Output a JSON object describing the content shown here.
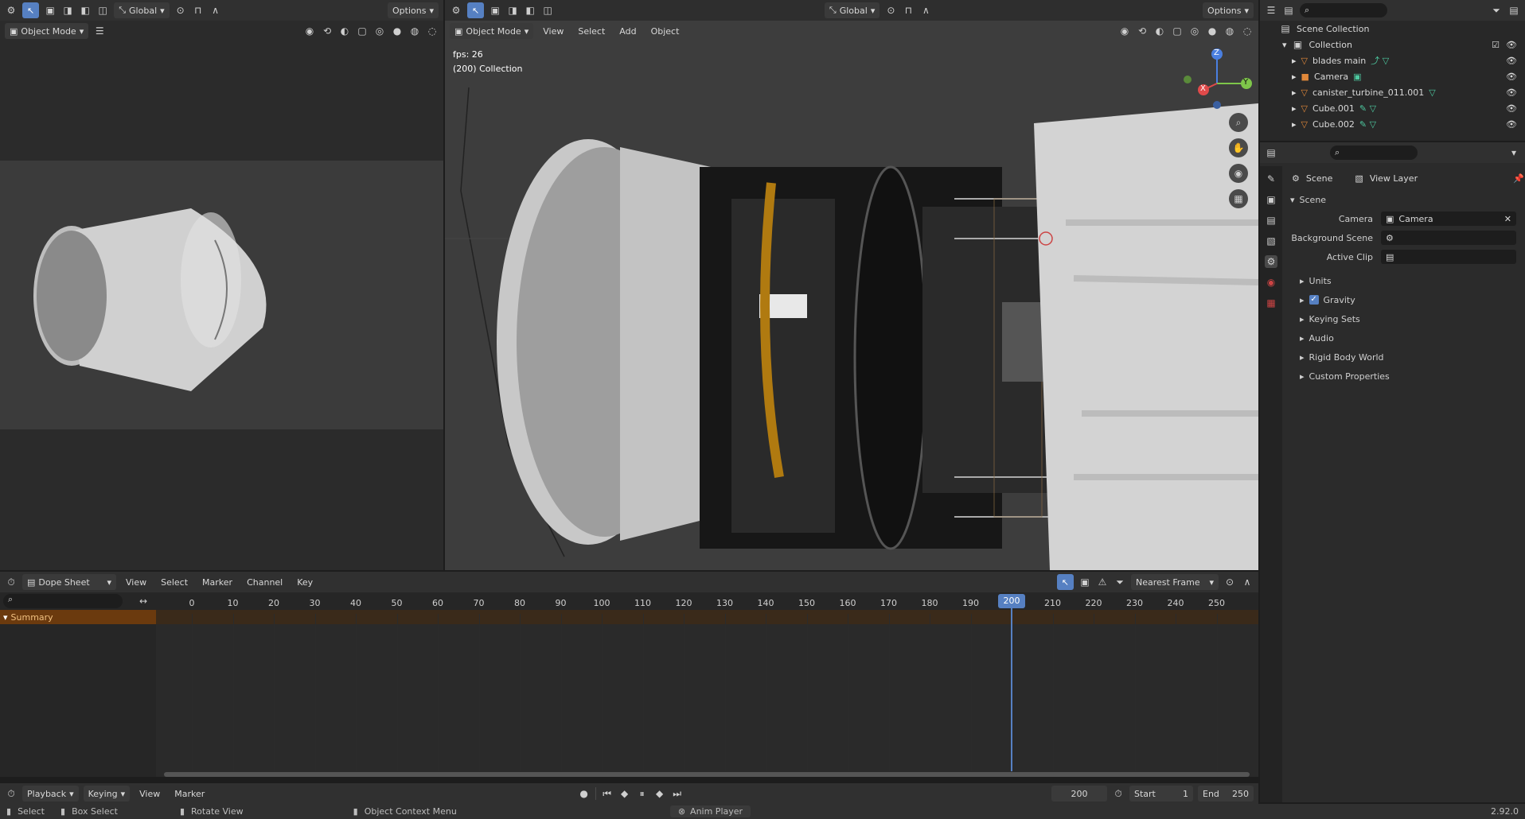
{
  "left_viewport": {
    "header": {
      "orientation_label": "Global",
      "options_label": "Options",
      "mode_label": "Object Mode"
    }
  },
  "main_viewport": {
    "header": {
      "mode_label": "Object Mode",
      "menu": [
        "View",
        "Select",
        "Add",
        "Object"
      ],
      "orientation_label": "Global",
      "options_label": "Options"
    },
    "overlay": {
      "fps": "fps: 26",
      "collection": "(200) Collection"
    },
    "gizmo": {
      "z": "Z",
      "y": "Y",
      "x": "X"
    }
  },
  "outliner": {
    "root": "Scene Collection",
    "collection": "Collection",
    "items": [
      {
        "label": "blades main"
      },
      {
        "label": "Camera"
      },
      {
        "label": "canister_turbine_011.001"
      },
      {
        "label": "Cube.001"
      },
      {
        "label": "Cube.002"
      }
    ]
  },
  "properties": {
    "tabs": {
      "scene": "Scene",
      "view_layer": "View Layer"
    },
    "section": "Scene",
    "fields": {
      "camera_label": "Camera",
      "camera_value": "Camera",
      "bg_label": "Background Scene",
      "clip_label": "Active Clip"
    },
    "panels": [
      "Units",
      "Gravity",
      "Keying Sets",
      "Audio",
      "Rigid Body World",
      "Custom Properties"
    ]
  },
  "dopesheet": {
    "header": {
      "editor_label": "Dope Sheet",
      "menu": [
        "View",
        "Select",
        "Marker",
        "Channel",
        "Key"
      ],
      "snap_label": "Nearest Frame"
    },
    "summary_label": "Summary",
    "ticks": [
      "0",
      "10",
      "20",
      "30",
      "40",
      "50",
      "60",
      "70",
      "80",
      "90",
      "100",
      "110",
      "120",
      "130",
      "140",
      "150",
      "160",
      "170",
      "180",
      "190",
      "200",
      "210",
      "220",
      "230",
      "240",
      "250"
    ],
    "current_frame": "200"
  },
  "timeline": {
    "menu": [
      "Playback",
      "Keying",
      "View",
      "Marker"
    ],
    "frame": "200",
    "start_label": "Start",
    "start_value": "1",
    "end_label": "End",
    "end_value": "250"
  },
  "statusbar": {
    "select": "Select",
    "box_select": "Box Select",
    "rotate_view": "Rotate View",
    "context_menu": "Object Context Menu",
    "anim_player": "Anim Player",
    "version": "2.92.0"
  },
  "colors": {
    "accent": "#5680c2",
    "summary": "#e0883a",
    "header": "#303030",
    "viewport": "#3d3d3d"
  }
}
